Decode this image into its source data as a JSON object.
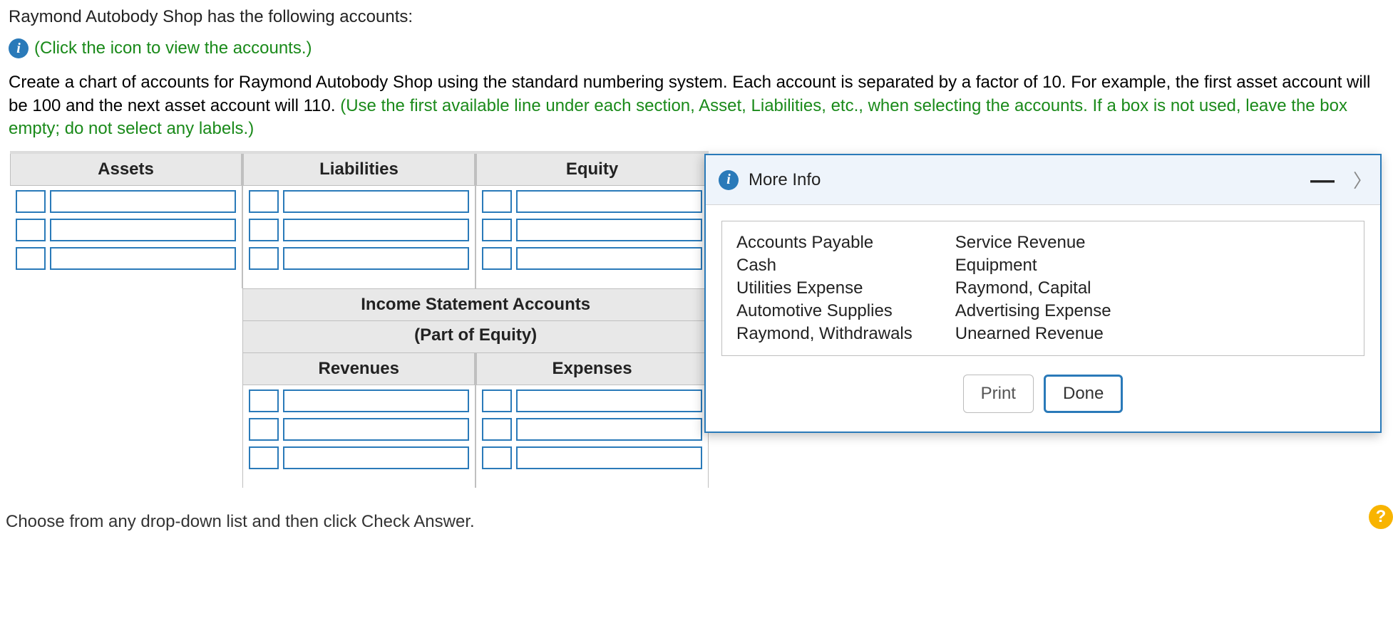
{
  "intro": {
    "line1": "Raymond Autobody Shop has the following accounts:",
    "info_hint": "(Click the icon to view the accounts.)",
    "para_black": "Create a chart of accounts for Raymond Autobody Shop using the standard numbering system. Each account is separated by a factor of 10. For example, the first asset account will be 100 and the next asset account will 110. ",
    "para_green": "(Use the first available line under each section, Asset, Liabilities, etc., when selecting the accounts. If a box is not used, leave the box empty; do not select any labels.)"
  },
  "worksheet": {
    "headers": {
      "assets": "Assets",
      "liabilities": "Liabilities",
      "equity": "Equity"
    },
    "isa_header": "Income Statement Accounts",
    "isa_sub": "(Part of Equity)",
    "rev_header": "Revenues",
    "exp_header": "Expenses"
  },
  "popup": {
    "title": "More Info",
    "accounts_left": [
      "Accounts Payable",
      "Cash",
      "Utilities Expense",
      "Automotive Supplies",
      "Raymond, Withdrawals"
    ],
    "accounts_right": [
      "Service Revenue",
      "Equipment",
      "Raymond, Capital",
      "Advertising Expense",
      "Unearned Revenue"
    ],
    "print_label": "Print",
    "done_label": "Done"
  },
  "footer": "Choose from any drop-down list and then click Check Answer.",
  "help": "?"
}
